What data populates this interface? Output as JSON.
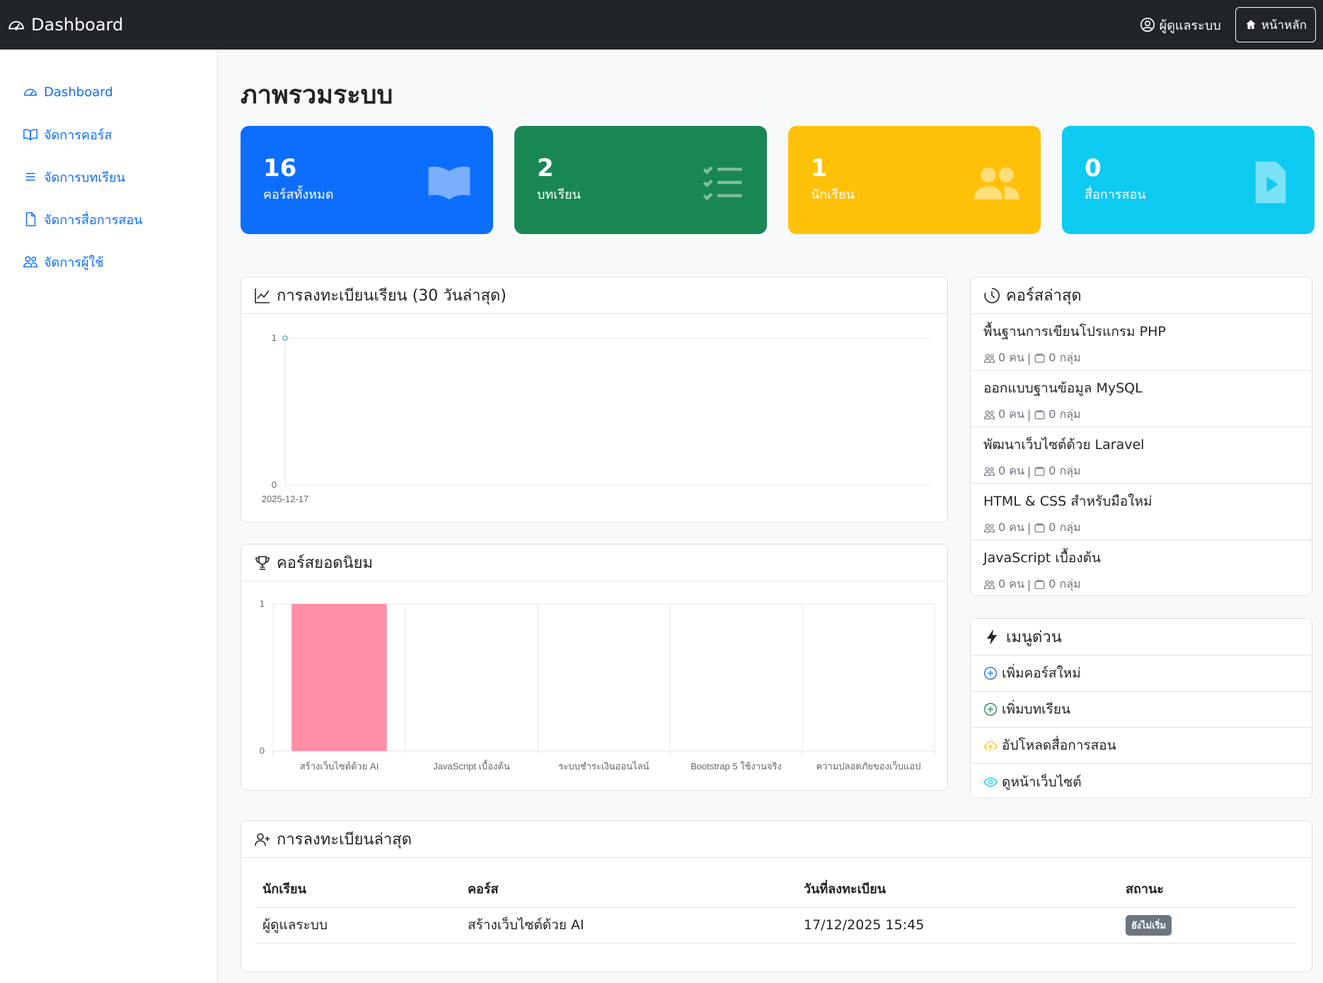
{
  "topbar": {
    "brand": "Dashboard",
    "admin_label": "ผู้ดูแลระบบ",
    "home_label": "หน้าหลัก"
  },
  "sidebar": {
    "items": [
      {
        "label": "Dashboard",
        "icon": "speedometer-icon"
      },
      {
        "label": "จัดการคอร์ส",
        "icon": "book-icon"
      },
      {
        "label": "จัดการบทเรียน",
        "icon": "list-icon"
      },
      {
        "label": "จัดการสื่อการสอน",
        "icon": "file-icon"
      },
      {
        "label": "จัดการผู้ใช้",
        "icon": "people-icon"
      }
    ]
  },
  "page": {
    "title": "ภาพรวมระบบ"
  },
  "stats": [
    {
      "value": "16",
      "label": "คอร์สทั้งหมด",
      "color": "#0d6efd",
      "icon": "book-icon"
    },
    {
      "value": "2",
      "label": "บทเรียน",
      "color": "#198754",
      "icon": "checklist-icon"
    },
    {
      "value": "1",
      "label": "นักเรียน",
      "color": "#ffc107",
      "icon": "people-icon"
    },
    {
      "value": "0",
      "label": "สื่อการสอน",
      "color": "#0dcaf0",
      "icon": "video-file-icon"
    }
  ],
  "enroll_chart": {
    "header": "การลงทะเบียนเรียน (30 วันล่าสุด)"
  },
  "popular_chart": {
    "header": "คอร์สยอดนิยม"
  },
  "chart_data": [
    {
      "type": "line",
      "x": [
        "2025-12-17"
      ],
      "series": [
        {
          "values": [
            1
          ],
          "color": "#4bc0c0"
        }
      ],
      "ylim": [
        0,
        1
      ],
      "yticks": [
        "0",
        "1"
      ],
      "title": "",
      "xlabel": "",
      "ylabel": ""
    },
    {
      "type": "bar",
      "categories": [
        "สร้างเว็บไซต์ด้วย AI",
        "JavaScript เบื้องต้น",
        "ระบบชำระเงินออนไลน์",
        "Bootstrap 5 ใช้งานจริง",
        "ความปลอดภัยของเว็บแอป"
      ],
      "values": [
        1,
        0,
        0,
        0,
        0
      ],
      "ylim": [
        0,
        1
      ],
      "yticks": [
        "0",
        "1"
      ],
      "bar_color": "#ff8fa6",
      "title": "",
      "xlabel": "",
      "ylabel": ""
    }
  ],
  "recent_courses": {
    "header": "คอร์สล่าสุด",
    "items": [
      {
        "title": "พื้นฐานการเขียนโปรแกรม PHP",
        "people": "0 คน",
        "sep": "|",
        "groups": "0 กลุ่ม"
      },
      {
        "title": "ออกแบบฐานข้อมูล MySQL",
        "people": "0 คน",
        "sep": "|",
        "groups": "0 กลุ่ม"
      },
      {
        "title": "พัฒนาเว็บไซต์ด้วย Laravel",
        "people": "0 คน",
        "sep": "|",
        "groups": "0 กลุ่ม"
      },
      {
        "title": "HTML & CSS สำหรับมือใหม่",
        "people": "0 คน",
        "sep": "|",
        "groups": "0 กลุ่ม"
      },
      {
        "title": "JavaScript เบื้องต้น",
        "people": "0 คน",
        "sep": "|",
        "groups": "0 กลุ่ม"
      }
    ]
  },
  "quick_menu": {
    "header": "เมนูด่วน",
    "items": [
      {
        "label": "เพิ่มคอร์สใหม่",
        "icon": "plus-circle-icon",
        "color": "#0d6efd"
      },
      {
        "label": "เพิ่มบทเรียน",
        "icon": "plus-circle-icon",
        "color": "#198754"
      },
      {
        "label": "อัปโหลดสื่อการสอน",
        "icon": "cloud-upload-icon",
        "color": "#ffc107"
      },
      {
        "label": "ดูหน้าเว็บไซต์",
        "icon": "eye-icon",
        "color": "#0dcaf0"
      }
    ]
  },
  "recent_enrollments": {
    "header": "การลงทะเบียนล่าสุด",
    "columns": [
      "นักเรียน",
      "คอร์ส",
      "วันที่ลงทะเบียน",
      "สถานะ"
    ],
    "rows": [
      {
        "student": "ผู้ดูแลระบบ",
        "course": "สร้างเว็บไซต์ด้วย AI",
        "date": "17/12/2025 15:45",
        "status": "ยังไม่เริ่ม"
      }
    ]
  }
}
